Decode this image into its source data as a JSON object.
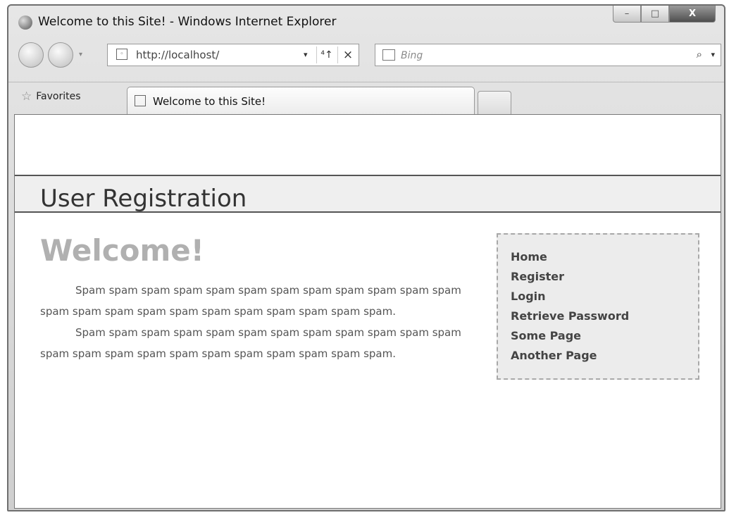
{
  "window": {
    "title": "Welcome to this Site! - Windows Internet Explorer",
    "controls": {
      "minimize": "–",
      "maximize": "□",
      "close": "X"
    }
  },
  "toolbar": {
    "address": "http://localhost/",
    "address_dropdown": "▾",
    "refresh": "⁴↑",
    "stop": "×",
    "search_placeholder": "Bing",
    "search_icon": "⌕",
    "search_dropdown": "▾",
    "nav_dropdown": "▾"
  },
  "tabbar": {
    "favorites": "Favorites",
    "favorites_icon": "☆",
    "active_tab": "Welcome to this Site!"
  },
  "page": {
    "banner_title": "User Registration",
    "heading": "Welcome!",
    "paragraphs": [
      "Spam spam spam spam spam spam spam spam spam spam spam spam spam spam spam spam spam spam spam spam spam spam spam.",
      "Spam spam spam spam spam spam spam spam spam spam spam spam spam spam spam spam spam spam spam spam spam spam spam."
    ],
    "sidebar_links": [
      "Home",
      "Register",
      "Login",
      "Retrieve Password",
      "Some Page",
      "Another Page"
    ]
  },
  "colors": {
    "heading": "#b0b0b0",
    "banner_bg": "#efefef",
    "sidebar_bg": "#ececec"
  }
}
